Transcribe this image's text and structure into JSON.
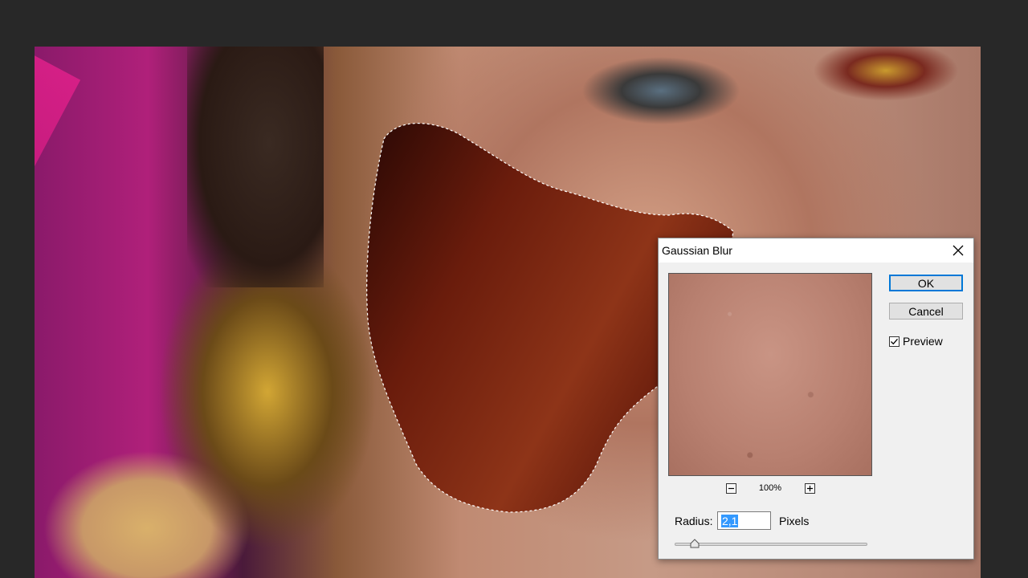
{
  "dialog": {
    "title": "Gaussian Blur",
    "ok_label": "OK",
    "cancel_label": "Cancel",
    "preview_label": "Preview",
    "preview_checked": true,
    "zoom_level": "100%",
    "radius_label": "Radius:",
    "radius_value": "2,1",
    "radius_unit": "Pixels"
  },
  "icons": {
    "close": "close-icon",
    "zoom_out": "zoom-out-icon",
    "zoom_in": "zoom-in-icon",
    "checkmark": "checkmark-icon"
  },
  "colors": {
    "workspace_bg": "#282828",
    "dialog_bg": "#f0f0f0",
    "accent": "#0078d7",
    "selection_highlight": "#3399ff",
    "selection_fill": "#8a2a14"
  }
}
